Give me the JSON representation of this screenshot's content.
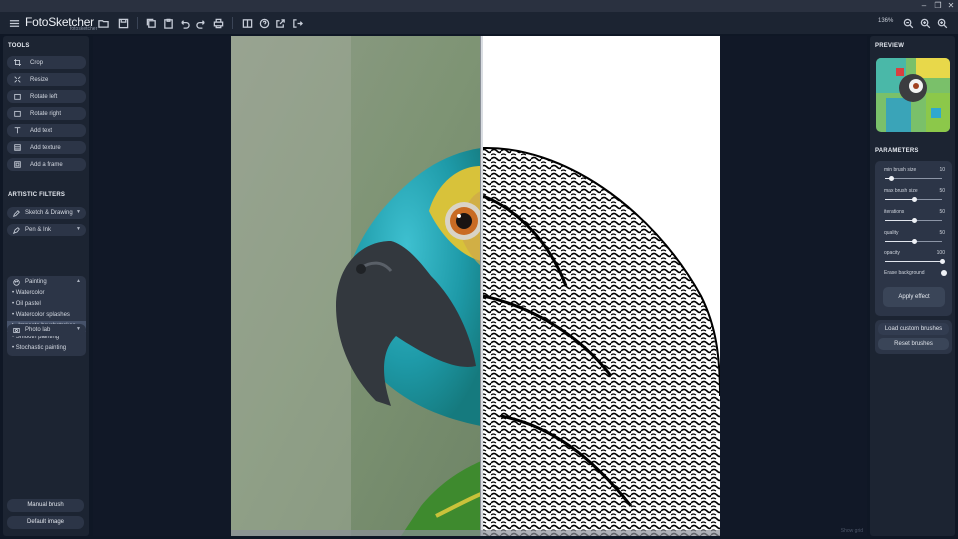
{
  "app": {
    "name": "FotoSketcher",
    "subtitle": "fotosketcher",
    "zoom": "136%"
  },
  "left": {
    "tools_title": "TOOLS",
    "tools": [
      "Crop",
      "Resize",
      "Rotate left",
      "Rotate right",
      "Add text",
      "Add texture",
      "Add a frame"
    ],
    "filters_title": "ARTISTIC FILTERS",
    "sketch_drawing": "Sketch & Drawing",
    "pen_ink": "Pen & Ink",
    "painting": "Painting",
    "painting_items": [
      "• Watercolor",
      "• Oil pastel",
      "• Watercolor splashes",
      "▶ Impasto brushstrokes",
      "• Smooth painting",
      "• Stochastic painting"
    ],
    "photo_lab": "Photo lab",
    "manual_brush": "Manual brush",
    "default_image": "Default image"
  },
  "right": {
    "preview_title": "PREVIEW",
    "parameters_title": "PARAMETERS",
    "params": [
      {
        "label": "min brush size",
        "value": "10",
        "fraction": 0.1
      },
      {
        "label": "max brush size",
        "value": "50",
        "fraction": 0.5
      },
      {
        "label": "iterations",
        "value": "50",
        "fraction": 0.5
      },
      {
        "label": "quality",
        "value": "50",
        "fraction": 0.5
      },
      {
        "label": "opacity",
        "value": "100",
        "fraction": 1.0
      }
    ],
    "erase_background": "Erase background",
    "apply_effect": "Apply effect",
    "load_custom_brushes": "Load custom brushes",
    "reset_brushes": "Reset brushes"
  },
  "canvas": {
    "show_grid": "Show grid"
  },
  "colors": {
    "accent": "#2c3547",
    "panel": "#1c2432",
    "background": "#0f1725"
  }
}
